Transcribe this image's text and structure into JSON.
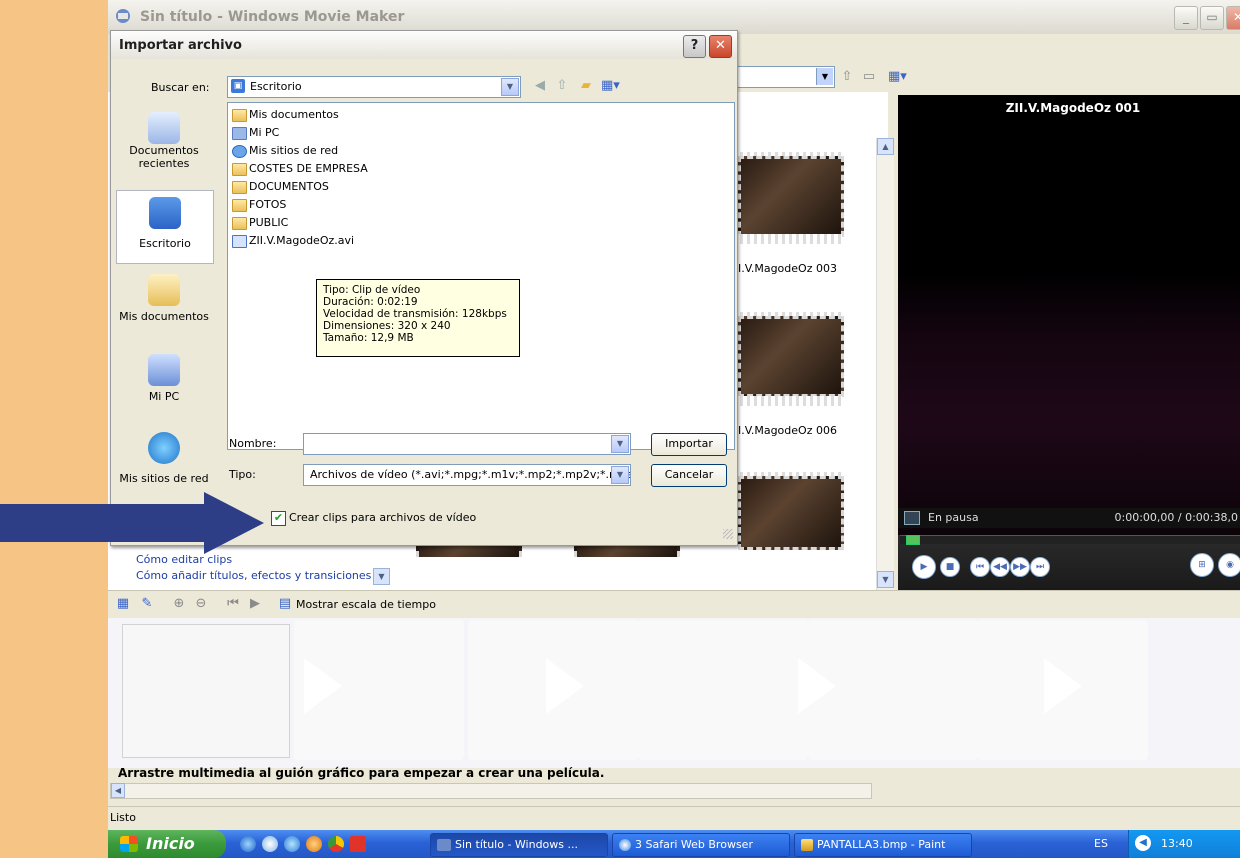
{
  "window": {
    "title": "Sin título - Windows Movie Maker",
    "status": "Listo"
  },
  "dialog": {
    "title": "Importar archivo",
    "help": "?",
    "close": "✕",
    "look_in_label": "Buscar en:",
    "look_in_value": "Escritorio",
    "places": [
      {
        "label": "Documentos recientes"
      },
      {
        "label": "Escritorio"
      },
      {
        "label": "Mis documentos"
      },
      {
        "label": "Mi PC"
      },
      {
        "label": "Mis sitios de red"
      }
    ],
    "files": [
      {
        "name": "Mis documentos",
        "icon": "mydocs"
      },
      {
        "name": "Mi PC",
        "icon": "mypc"
      },
      {
        "name": "Mis sitios de red",
        "icon": "mynet"
      },
      {
        "name": "COSTES DE EMPRESA",
        "icon": "folder"
      },
      {
        "name": "DOCUMENTOS",
        "icon": "shared"
      },
      {
        "name": "FOTOS",
        "icon": "shared"
      },
      {
        "name": "PUBLIC",
        "icon": "shared"
      },
      {
        "name": "ZII.V.MagodeOz.avi",
        "icon": "avi"
      }
    ],
    "tooltip": {
      "type": "Tipo: Clip de vídeo",
      "duration": "Duración: 0:02:19",
      "bitrate": "Velocidad de transmisión: 128kbps",
      "dimensions": "Dimensiones: 320 x 240",
      "size": "Tamaño: 12,9 MB"
    },
    "name_label": "Nombre:",
    "name_value": "",
    "type_label": "Tipo:",
    "type_value": "Archivos de vídeo (*.avi;*.mpg;*.m1v;*.mp2;*.mp2v;*.mpe",
    "import_button": "Importar",
    "cancel_button": "Cancelar",
    "checkbox_label": "Crear clips para archivos de vídeo",
    "checkbox_checked": true
  },
  "collection": {
    "clips": [
      {
        "label": "I.V.MagodeOz 003"
      },
      {
        "label": "I.V.MagodeOz 006"
      }
    ],
    "tasks": [
      {
        "label": "Cómo editar clips"
      },
      {
        "label": "Cómo añadir títulos, efectos y transiciones"
      }
    ]
  },
  "monitor": {
    "title": "ZII.V.MagodeOz 001",
    "status": "En pausa",
    "time": "0:00:00,00 / 0:00:38,0"
  },
  "storyboard": {
    "show_timeline_label": "Mostrar escala de tiempo",
    "hint": "Arrastre multimedia al guión gráfico para empezar a crear una película."
  },
  "taskbar": {
    "start": "Inicio",
    "tasks": [
      {
        "label": "Sin título - Windows ..."
      },
      {
        "label": "3 Safari Web Browser"
      },
      {
        "label": "PANTALLA3.bmp - Paint"
      }
    ],
    "lang": "ES",
    "clock": "13:40"
  },
  "colors": {
    "background": "#f6c586",
    "arrow": "#2d3e87",
    "xp_blue": "#2457c7",
    "xp_green": "#3a9a3a"
  }
}
